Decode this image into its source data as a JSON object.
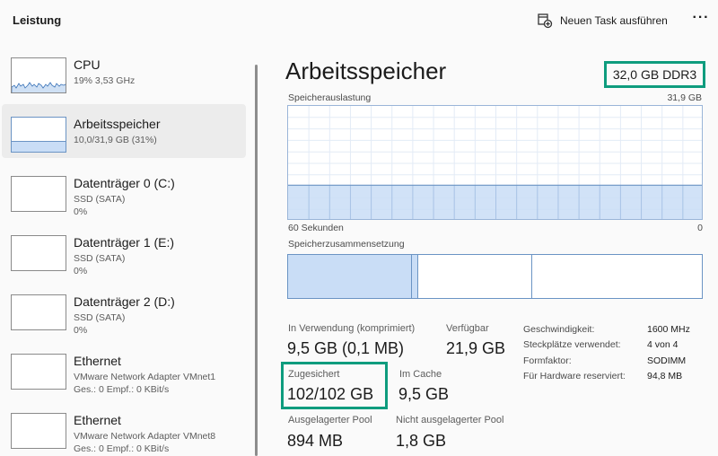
{
  "header": {
    "title": "Leistung",
    "new_task_label": "Neuen Task ausführen",
    "more_label": "···"
  },
  "sidebar": {
    "items": [
      {
        "title": "CPU",
        "lines": [
          "19%  3,53 GHz"
        ]
      },
      {
        "title": "Arbeitsspeicher",
        "lines": [
          "10,0/31,9 GB (31%)"
        ]
      },
      {
        "title": "Datenträger 0 (C:)",
        "lines": [
          "SSD (SATA)",
          "0%"
        ]
      },
      {
        "title": "Datenträger 1 (E:)",
        "lines": [
          "SSD (SATA)",
          "0%"
        ]
      },
      {
        "title": "Datenträger 2 (D:)",
        "lines": [
          "SSD (SATA)",
          "0%"
        ]
      },
      {
        "title": "Ethernet",
        "lines": [
          "VMware Network Adapter VMnet1",
          "Ges.: 0 Empf.: 0 KBit/s"
        ]
      },
      {
        "title": "Ethernet",
        "lines": [
          "VMware Network Adapter VMnet8",
          "Ges.: 0 Empf.: 0 KBit/s"
        ]
      }
    ]
  },
  "main": {
    "title": "Arbeitsspeicher",
    "spec": "32,0 GB DDR3",
    "graph": {
      "label": "Speicherauslastung",
      "max_label": "31,9 GB",
      "time_label": "60 Sekunden",
      "zero_label": "0",
      "usage_fraction": 0.31
    },
    "composition": {
      "label": "Speicherzusammensetzung",
      "in_use_fraction": 0.3,
      "modified_fraction": 0.016,
      "standby_fraction": 0.275
    },
    "stats": {
      "in_use_label": "In Verwendung (komprimiert)",
      "in_use_value": "9,5 GB (0,1 MB)",
      "available_label": "Verfügbar",
      "available_value": "21,9 GB",
      "committed_label": "Zugesichert",
      "committed_value": "102/102 GB",
      "cached_label": "Im Cache",
      "cached_value": "9,5 GB",
      "paged_label": "Ausgelagerter Pool",
      "paged_value": "894 MB",
      "nonpaged_label": "Nicht ausgelagerter Pool",
      "nonpaged_value": "1,8 GB"
    },
    "details": [
      {
        "key": "Geschwindigkeit:",
        "value": "1600 MHz"
      },
      {
        "key": "Steckplätze verwendet:",
        "value": "4 von 4"
      },
      {
        "key": "Formfaktor:",
        "value": "SODIMM"
      },
      {
        "key": "Für Hardware reserviert:",
        "value": "94,8 MB"
      }
    ]
  },
  "colors": {
    "accent_highlight": "#0e9c7e",
    "memory_fill": "#c9ddf6",
    "memory_line": "#6b94c4"
  }
}
